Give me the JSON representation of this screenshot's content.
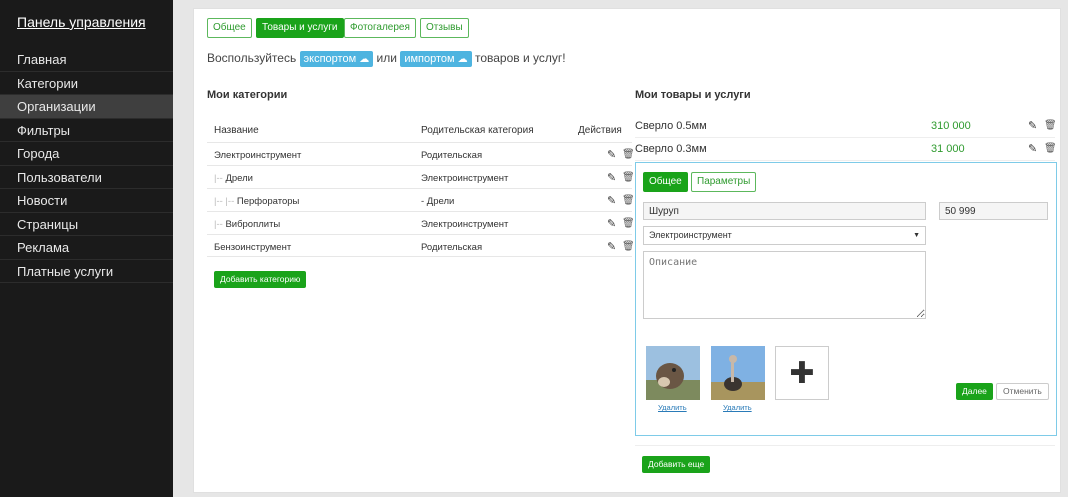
{
  "sidebar": {
    "title": "Панель управления",
    "items": [
      {
        "label": "Главная"
      },
      {
        "label": "Категории"
      },
      {
        "label": "Организации",
        "active": true
      },
      {
        "label": "Фильтры"
      },
      {
        "label": "Города"
      },
      {
        "label": "Пользователи"
      },
      {
        "label": "Новости"
      },
      {
        "label": "Страницы"
      },
      {
        "label": "Реклама"
      },
      {
        "label": "Платные услуги"
      }
    ]
  },
  "tabs": [
    "Общее",
    "Товары и услуги",
    "Фотогалерея",
    "Отзывы"
  ],
  "active_tab": "Товары и услуги",
  "note": {
    "pre": "Воспользуйтесь",
    "export": "экспортом",
    "middle": "или",
    "import": "импортом",
    "post": "товаров и услуг!"
  },
  "categories": {
    "title": "Мои категории",
    "columns": {
      "name": "Название",
      "parent": "Родительская категория",
      "actions": "Действия"
    },
    "rows": [
      {
        "prefix": "",
        "name": "Электроинструмент",
        "parent": "Родительская"
      },
      {
        "prefix": "|-- ",
        "name": "Дрели",
        "parent": "Электроинструмент"
      },
      {
        "prefix": "|-- |-- ",
        "name": "Перфораторы",
        "parent": "- Дрели"
      },
      {
        "prefix": "|-- ",
        "name": "Виброплиты",
        "parent": "Электроинструмент"
      },
      {
        "prefix": "",
        "name": "Бензоинструмент",
        "parent": "Родительская"
      }
    ],
    "add_button": "Добавить категорию"
  },
  "products": {
    "title": "Мои товары и услуги",
    "items": [
      {
        "name": "Сверло 0.5мм",
        "price": "310 000"
      },
      {
        "name": "Сверло 0.3мм",
        "price": "31 000"
      }
    ],
    "editor": {
      "tabs": [
        "Общее",
        "Параметры"
      ],
      "name_value": "Шуруп",
      "price_value": "50 999",
      "category_value": "Электроинструмент",
      "description_placeholder": "Описание",
      "delete_label": "Удалить",
      "next_button": "Далее",
      "cancel_button": "Отменить"
    },
    "add_more_button": "Добавить еще"
  },
  "colors": {
    "accent": "#1aa31a",
    "info": "#4eb4e0",
    "sidebar": "#1a1a1a"
  }
}
